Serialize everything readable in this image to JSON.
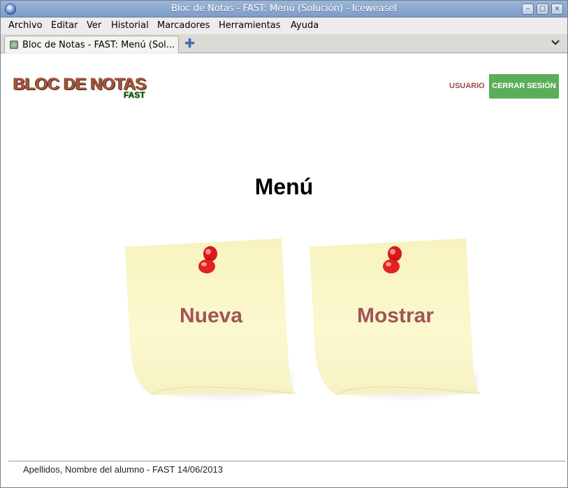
{
  "window": {
    "title": "Bloc de Notas - FAST: Menú (Solución) - Iceweasel",
    "minimize_glyph": "–",
    "maximize_glyph": "□",
    "close_glyph": "×"
  },
  "menubar": {
    "items": [
      "Archivo",
      "Editar",
      "Ver",
      "Historial",
      "Marcadores",
      "Herramientas",
      "Ayuda"
    ]
  },
  "tabs": {
    "items": [
      {
        "label": "Bloc de Notas - FAST: Menú (Sol..."
      }
    ],
    "new_tab_glyph": "✚",
    "list_glyph": "⌄"
  },
  "header": {
    "logo_main": "BLOC DE NOTAS",
    "logo_sub": "FAST",
    "user_link": "USUARIO",
    "logout_button": "CERRAR SESIÓN"
  },
  "main": {
    "title": "Menú",
    "notes": [
      {
        "label": "Nueva"
      },
      {
        "label": "Mostrar"
      }
    ]
  },
  "footer": {
    "text": "Apellidos, Nombre del alumno - FAST 14/06/2013"
  },
  "colors": {
    "logout_bg": "#5aae5a",
    "note_text": "#a25357",
    "note_paper": "#fbf8c8",
    "pin": "#e02020"
  }
}
